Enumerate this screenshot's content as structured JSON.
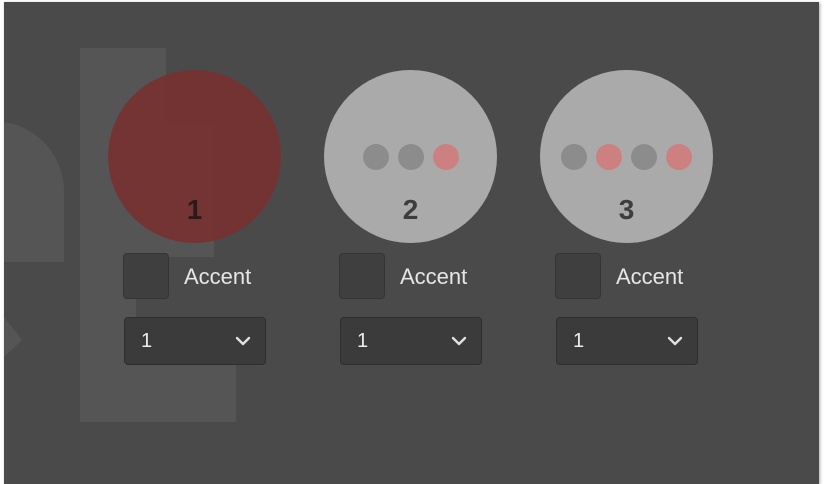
{
  "colors": {
    "background": "#4a4a4a",
    "circle": "#aaaaaa",
    "circle_accent_filled": "#7a3030",
    "dot_gray": "#8c8c8c",
    "dot_red": "#cc8080",
    "control_bg": "#3b3b3b",
    "text": "#e6e6e6"
  },
  "slots": [
    {
      "number": "1",
      "dots": [],
      "accent_filled": true,
      "checkbox_label": "Accent",
      "checkbox_checked": false,
      "select_value": "1"
    },
    {
      "number": "2",
      "dots": [
        "gray",
        "gray",
        "red"
      ],
      "accent_filled": false,
      "checkbox_label": "Accent",
      "checkbox_checked": false,
      "select_value": "1"
    },
    {
      "number": "3",
      "dots": [
        "gray",
        "red",
        "gray",
        "red"
      ],
      "accent_filled": false,
      "checkbox_label": "Accent",
      "checkbox_checked": false,
      "select_value": "1"
    }
  ],
  "icons": {
    "select_arrow": "chevron-down-icon",
    "background_mark": "watermark-logo"
  }
}
